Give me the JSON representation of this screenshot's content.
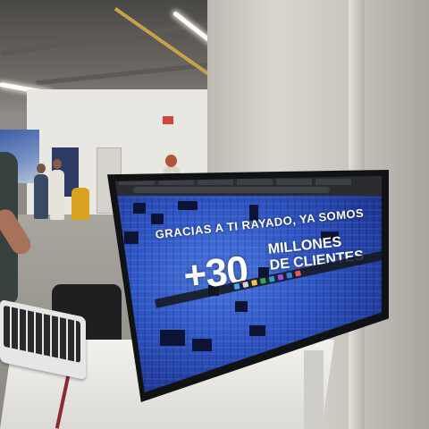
{
  "scene": {
    "description_type": "photo",
    "screen_content": {
      "headline": "GRACIAS A TI RAYADO, YA SOMOS",
      "big_number": "+30",
      "big_label_line1": "MILLONES",
      "big_label_line2": "DE CLIENTES"
    }
  },
  "colors": {
    "screen_blue": "#2f56c5",
    "column_concrete": "#cbc8c1",
    "table_white": "#f2f1ee"
  }
}
